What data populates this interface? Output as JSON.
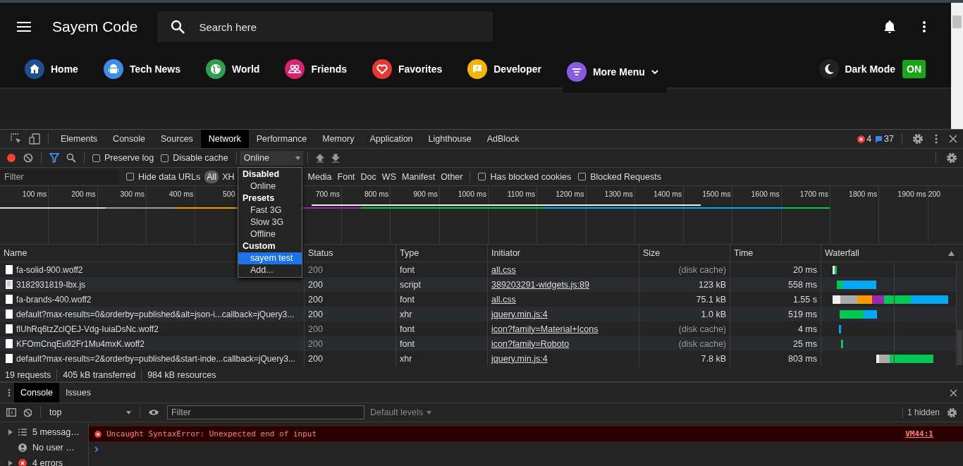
{
  "site": {
    "title": "Sayem Code",
    "search": {
      "placeholder": "Search here"
    },
    "nav": [
      {
        "label": "Home",
        "color": "#1f4f8f"
      },
      {
        "label": "Tech News",
        "color": "#3d8eea"
      },
      {
        "label": "World",
        "color": "#2f9e50"
      },
      {
        "label": "Friends",
        "color": "#d6246e"
      },
      {
        "label": "Favorites",
        "color": "#e53935"
      },
      {
        "label": "Developer",
        "color": "#f4b400"
      },
      {
        "label": "More Menu",
        "color": "#8a5ce6",
        "dropdown": true
      }
    ],
    "dark_mode": {
      "label": "Dark Mode",
      "badge": "ON",
      "on": true
    }
  },
  "devtools": {
    "tabs": [
      {
        "label": "Elements",
        "selected": false
      },
      {
        "label": "Console",
        "selected": false
      },
      {
        "label": "Sources",
        "selected": false
      },
      {
        "label": "Network",
        "selected": true
      },
      {
        "label": "Performance",
        "selected": false
      },
      {
        "label": "Memory",
        "selected": false
      },
      {
        "label": "Application",
        "selected": false
      },
      {
        "label": "Lighthouse",
        "selected": false
      },
      {
        "label": "AdBlock",
        "selected": false
      }
    ],
    "errors": "4",
    "messages": "37",
    "toolbar": {
      "recording": true,
      "checkboxes": [
        {
          "label": "Preserve log",
          "checked": false
        },
        {
          "label": "Disable cache",
          "checked": false
        }
      ],
      "throttle": "Online"
    },
    "filter": {
      "placeholder": "Filter",
      "hide_data_urls": {
        "label": "Hide data URLs",
        "checked": false
      },
      "types": [
        {
          "label": "All",
          "selected": true
        },
        {
          "label": "XH",
          "selected": false
        },
        {
          "label": "Media",
          "selected": false
        },
        {
          "label": "Font",
          "selected": false
        },
        {
          "label": "Doc",
          "selected": false
        },
        {
          "label": "WS",
          "selected": false
        },
        {
          "label": "Manifest",
          "selected": false
        },
        {
          "label": "Other",
          "selected": false
        }
      ],
      "checkboxes": [
        {
          "label": "Has blocked cookies",
          "checked": false
        },
        {
          "label": "Blocked Requests",
          "checked": false
        }
      ]
    },
    "throttle_menu": [
      {
        "kind": "header",
        "label": "Disabled"
      },
      {
        "kind": "option",
        "label": "Online",
        "selected": false
      },
      {
        "kind": "header",
        "label": "Presets"
      },
      {
        "kind": "option",
        "label": "Fast 3G",
        "selected": false
      },
      {
        "kind": "option",
        "label": "Slow 3G",
        "selected": false
      },
      {
        "kind": "option",
        "label": "Offline",
        "selected": false
      },
      {
        "kind": "header",
        "label": "Custom"
      },
      {
        "kind": "option",
        "label": "sayem test",
        "selected": true
      },
      {
        "kind": "option",
        "label": "Add...",
        "selected": false
      }
    ],
    "overview": {
      "ticks": [
        "100 ms",
        "200 ms",
        "300 ms",
        "400 ms",
        "500",
        "700 ms",
        "800 ms",
        "900 ms",
        "1000 ms",
        "1100 ms",
        "1200 ms",
        "1300 ms",
        "1400 ms",
        "1500 ms",
        "1600 ms",
        "1700 ms",
        "1800 ms",
        "1900 ms",
        "200"
      ]
    },
    "table": {
      "columns": [
        "Name",
        "Status",
        "Type",
        "Initiator",
        "Size",
        "Time",
        "Waterfall"
      ],
      "rows": [
        {
          "name": "fa-solid-900.woff2",
          "status": "200",
          "cached": true,
          "type": "font",
          "initiator": "all.css",
          "size": "(disk cache)",
          "time": "20 ms"
        },
        {
          "name": "3182931819-lbx.js",
          "status": "200",
          "cached": false,
          "type": "script",
          "initiator": "389203291-widgets.js:89",
          "size": "123 kB",
          "time": "558 ms"
        },
        {
          "name": "fa-brands-400.woff2",
          "status": "200",
          "cached": false,
          "type": "font",
          "initiator": "all.css",
          "size": "75.1 kB",
          "time": "1.55 s"
        },
        {
          "name": "default?max-results=0&orderby=published&alt=json-i...callback=jQuery3...",
          "status": "200",
          "cached": false,
          "type": "xhr",
          "initiator": "jquery.min.js:4",
          "size": "1.0 kB",
          "time": "519 ms"
        },
        {
          "name": "flUhRq6tzZclQEJ-Vdg-IuiaDsNc.woff2",
          "status": "200",
          "cached": true,
          "type": "font",
          "initiator": "icon?family=Material+Icons",
          "size": "(disk cache)",
          "time": "4 ms"
        },
        {
          "name": "KFOmCnqEu92Fr1Mu4mxK.woff2",
          "status": "200",
          "cached": true,
          "type": "font",
          "initiator": "icon?family=Roboto",
          "size": "(disk cache)",
          "time": "25 ms"
        },
        {
          "name": "default?max-results=2&orderby=published&start-inde...callback=jQuery3...",
          "status": "200",
          "cached": false,
          "type": "xhr",
          "initiator": "jquery.min.js:4",
          "size": "7.8 kB",
          "time": "803 ms"
        }
      ]
    },
    "summary": [
      "19 requests",
      "405 kB transferred",
      "984 kB resources"
    ]
  },
  "console": {
    "tabs": [
      {
        "label": "Console",
        "selected": true
      },
      {
        "label": "Issues",
        "selected": false
      }
    ],
    "context": "top",
    "filter_placeholder": "Filter",
    "levels": "Default levels",
    "hidden": "1 hidden",
    "sidebar": [
      {
        "kind": "messages",
        "label": "5 messag…"
      },
      {
        "kind": "user",
        "label": "No user …"
      },
      {
        "kind": "errors",
        "label": "4 errors"
      }
    ],
    "messages": [
      {
        "kind": "error",
        "text": "Uncaught SyntaxError: Unexpected end of input",
        "source": "VM44:1"
      }
    ]
  }
}
